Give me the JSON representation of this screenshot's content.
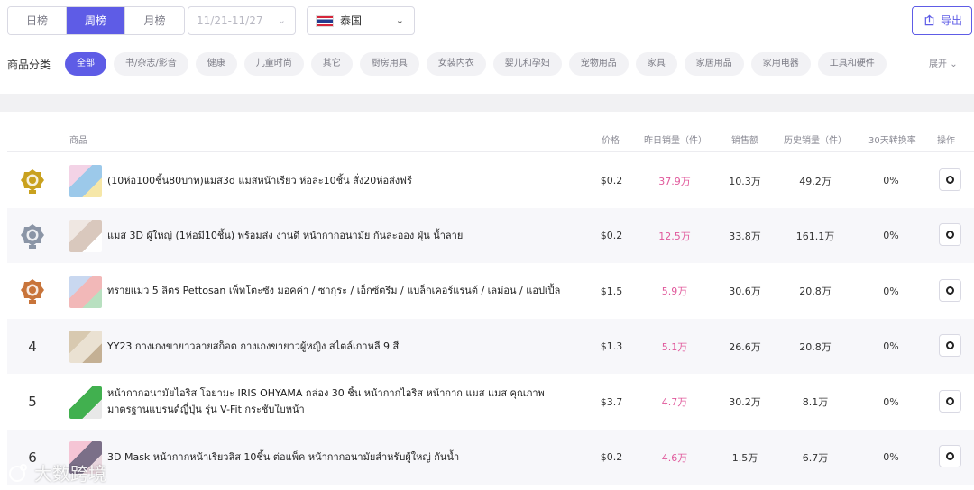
{
  "toolbar": {
    "periods": [
      "日榜",
      "周榜",
      "月榜"
    ],
    "active_period": "周榜",
    "date_range": "11/21-11/27",
    "country": "泰国",
    "export_label": "导出"
  },
  "categories": {
    "label": "商品分类",
    "items": [
      "全部",
      "书/杂志/影音",
      "健康",
      "儿童时尚",
      "其它",
      "厨房用具",
      "女装内衣",
      "婴儿和孕妇",
      "宠物用品",
      "家具",
      "家居用品",
      "家用电器",
      "工具和硬件"
    ],
    "active": "全部",
    "expand_label": "展开"
  },
  "table": {
    "headers": {
      "product": "商品",
      "price": "价格",
      "yesterday_sales": "昨日销量（件）",
      "revenue": "销售额",
      "total_sales": "历史销量（件）",
      "conversion": "30天转换率",
      "action": "操作"
    },
    "rows": [
      {
        "rank": "",
        "medal": "gold",
        "title": "(10ห่อ100ชิ้น80บาท)แมส3d แมสหน้าเรียว ห่อละ10ชิ้น สั่ง20ห่อส่งฟรี",
        "price": "$0.2",
        "yesterday_sales": "37.9万",
        "revenue": "10.3万",
        "total_sales": "49.2万",
        "conversion": "0%"
      },
      {
        "rank": "",
        "medal": "silver",
        "title": "แมส 3D ผู้ใหญ่ (1ห่อมี10ชิ้น) พร้อมส่ง งานดี หน้ากากอนามัย กันละออง ฝุ่น น้ำลาย",
        "price": "$0.2",
        "yesterday_sales": "12.5万",
        "revenue": "33.8万",
        "total_sales": "161.1万",
        "conversion": "0%"
      },
      {
        "rank": "",
        "medal": "bronze",
        "title": "ทรายแมว 5 ลิตร Pettosan เพ็ทโตะซัง มอคค่า / ซากุระ / เอ็กซ์ตรีม / แบล็กเคอร์แรนต์ / เลม่อน / แอปเปิ้ล",
        "price": "$1.5",
        "yesterday_sales": "5.9万",
        "revenue": "30.6万",
        "total_sales": "20.8万",
        "conversion": "0%"
      },
      {
        "rank": "4",
        "medal": "",
        "title": "YY23 กางเกงขายาวลายสก็อต กางเกงขายาวผู้หญิง สไตล์เกาหลี 9 สี",
        "price": "$1.3",
        "yesterday_sales": "5.1万",
        "revenue": "26.6万",
        "total_sales": "20.8万",
        "conversion": "0%"
      },
      {
        "rank": "5",
        "medal": "",
        "title": "หน้ากากอนามัยไอริส โอยามะ IRIS OHYAMA กล่อง 30 ชิ้น หน้ากากไอริส หน้ากาก แมส แมส คุณภาพมาตรฐานแบรนด์ญี่ปุ่น รุ่น V-Fit กระชับใบหน้า",
        "price": "$3.7",
        "yesterday_sales": "4.7万",
        "revenue": "30.2万",
        "total_sales": "8.1万",
        "conversion": "0%"
      },
      {
        "rank": "6",
        "medal": "",
        "title": "3D Mask หน้ากากหน้าเรียวลิส 10ชิ้น ต่อแพ็ค หน้ากากอนามัยสำหรับผู้ใหญ่ กันน้ำ",
        "price": "$0.2",
        "yesterday_sales": "4.6万",
        "revenue": "1.5万",
        "total_sales": "6.7万",
        "conversion": "0%"
      }
    ]
  },
  "watermark": "大数跨境",
  "colors": {
    "accent": "#5e5ce6",
    "sales_pink": "#e0589b",
    "gold": "#c9a11e",
    "silver": "#8b95a6",
    "bronze": "#c8743a"
  }
}
